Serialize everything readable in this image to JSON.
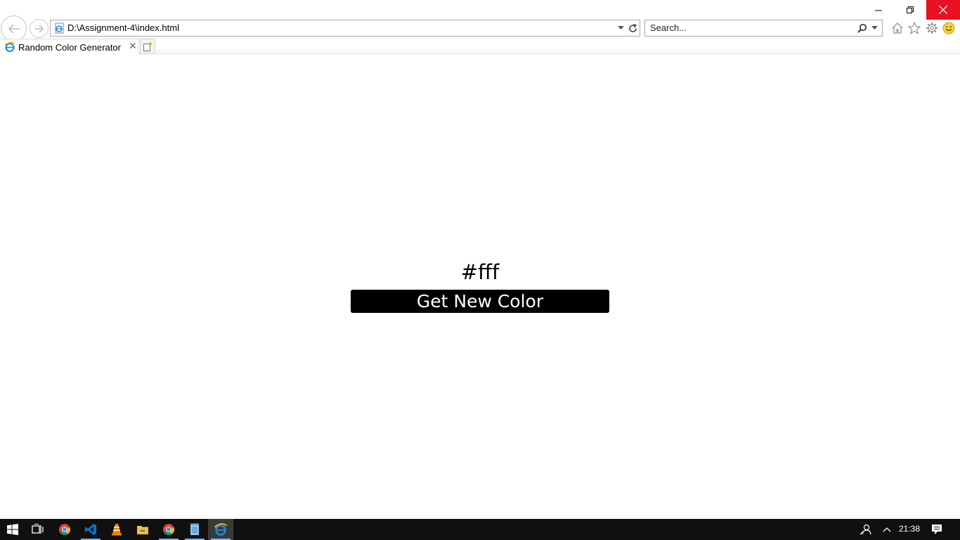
{
  "window": {
    "minimize_icon": "minimize-icon",
    "restore_icon": "restore-icon",
    "close_icon": "close-icon",
    "close_color": "#e81123"
  },
  "toolbar": {
    "address": "D:\\Assignment-4\\index.html",
    "search_placeholder": "Search..."
  },
  "tabs": [
    {
      "label": "Random Color Generator",
      "icon": "ie-icon"
    }
  ],
  "page": {
    "color_code": "#fff",
    "button_label": "Get New Color",
    "button_color": "#000000",
    "button_text_color": "#ffffff"
  },
  "taskbar": {
    "clock": "21:38",
    "apps": [
      "start-icon",
      "task-view-icon",
      "chrome-icon",
      "vscode-icon",
      "vlc-icon",
      "file-explorer-icon",
      "chrome-icon",
      "notepad-icon",
      "ie-icon"
    ],
    "accent": "#76b9ed"
  }
}
